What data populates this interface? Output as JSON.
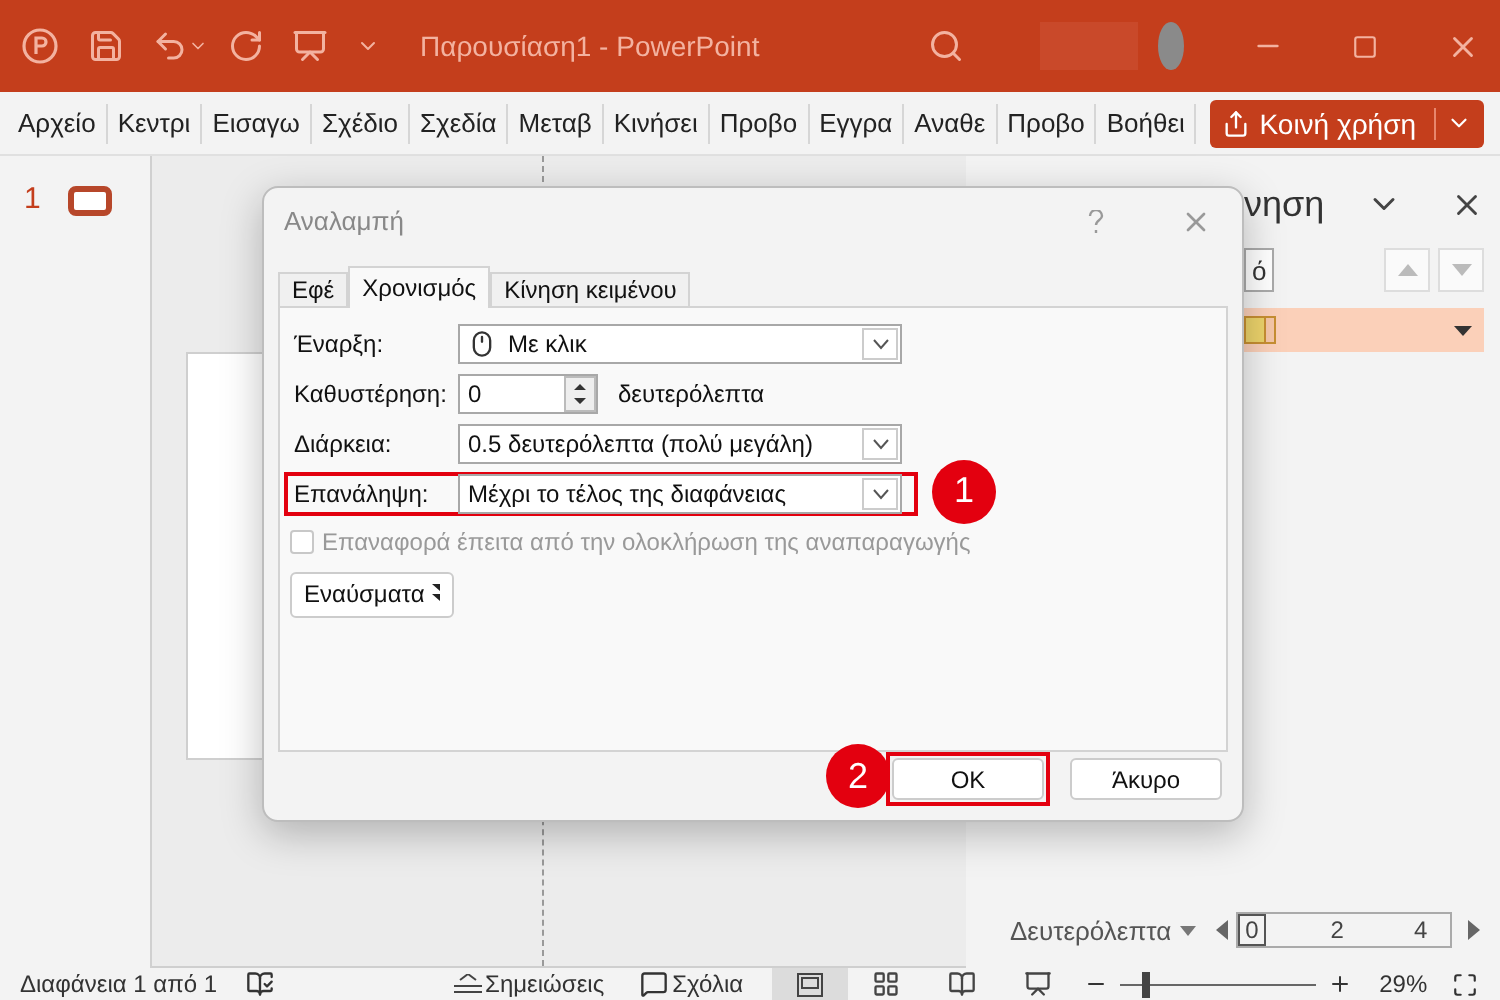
{
  "title_bar": {
    "title": "Παρουσίαση1  -  PowerPoint"
  },
  "ribbon_tabs": [
    "Αρχείο",
    "Κεντρι",
    "Εισαγω",
    "Σχέδιο",
    "Σχεδία",
    "Μεταβ",
    "Κινήσει",
    "Προβο",
    "Εγγρα",
    "Αναθε",
    "Προβο",
    "Βοήθει"
  ],
  "share_button": {
    "label": "Κοινή χρήση"
  },
  "thumbnails": [
    {
      "number": "1",
      "selected": true
    }
  ],
  "animation_pane": {
    "title": "νηση",
    "play_button": "ό",
    "timeline": {
      "label": "Δευτερόλεπτα",
      "ticks": [
        "0",
        "2",
        "4"
      ]
    }
  },
  "dialog": {
    "title": "Αναλαμπή",
    "tabs": [
      {
        "label": "Εφέ",
        "selected": false
      },
      {
        "label": "Χρονισμός",
        "selected": true
      },
      {
        "label": "Κίνηση κειμένου",
        "selected": false
      }
    ],
    "fields": [
      {
        "kind": "trigger",
        "label": "Έναρξη:",
        "value": "Με κλικ"
      },
      {
        "kind": "spin",
        "label": "Καθυστέρηση:",
        "value": "0",
        "unit": "δευτερόλεπτα"
      },
      {
        "kind": "dropdown",
        "label": "Διάρκεια:",
        "value": "0.5 δευτερόλεπτα (πολύ μεγάλη)"
      },
      {
        "kind": "dropdown",
        "label": "Επανάληψη:",
        "value": "Μέχρι το τέλος της διαφάνειας",
        "callout": "1"
      }
    ],
    "rewind": {
      "label": "Επαναφορά έπειτα από την ολοκλήρωση της αναπαραγωγής",
      "checked": false,
      "disabled": true
    },
    "triggers_button": "Εναύσματα",
    "buttons": [
      {
        "label": "OK",
        "callout": "2"
      },
      {
        "label": "Άκυρο"
      }
    ]
  },
  "status_bar": {
    "slide_info": "Διαφάνεια 1 από 1",
    "notes": "Σημειώσεις",
    "comments": "Σχόλια",
    "views": [
      {
        "kind": "normal",
        "selected": true
      },
      {
        "kind": "sorter",
        "selected": false
      },
      {
        "kind": "reading",
        "selected": false
      },
      {
        "kind": "slideshow",
        "selected": false
      }
    ],
    "zoom": {
      "level": 0.12,
      "reading": "29%"
    }
  }
}
